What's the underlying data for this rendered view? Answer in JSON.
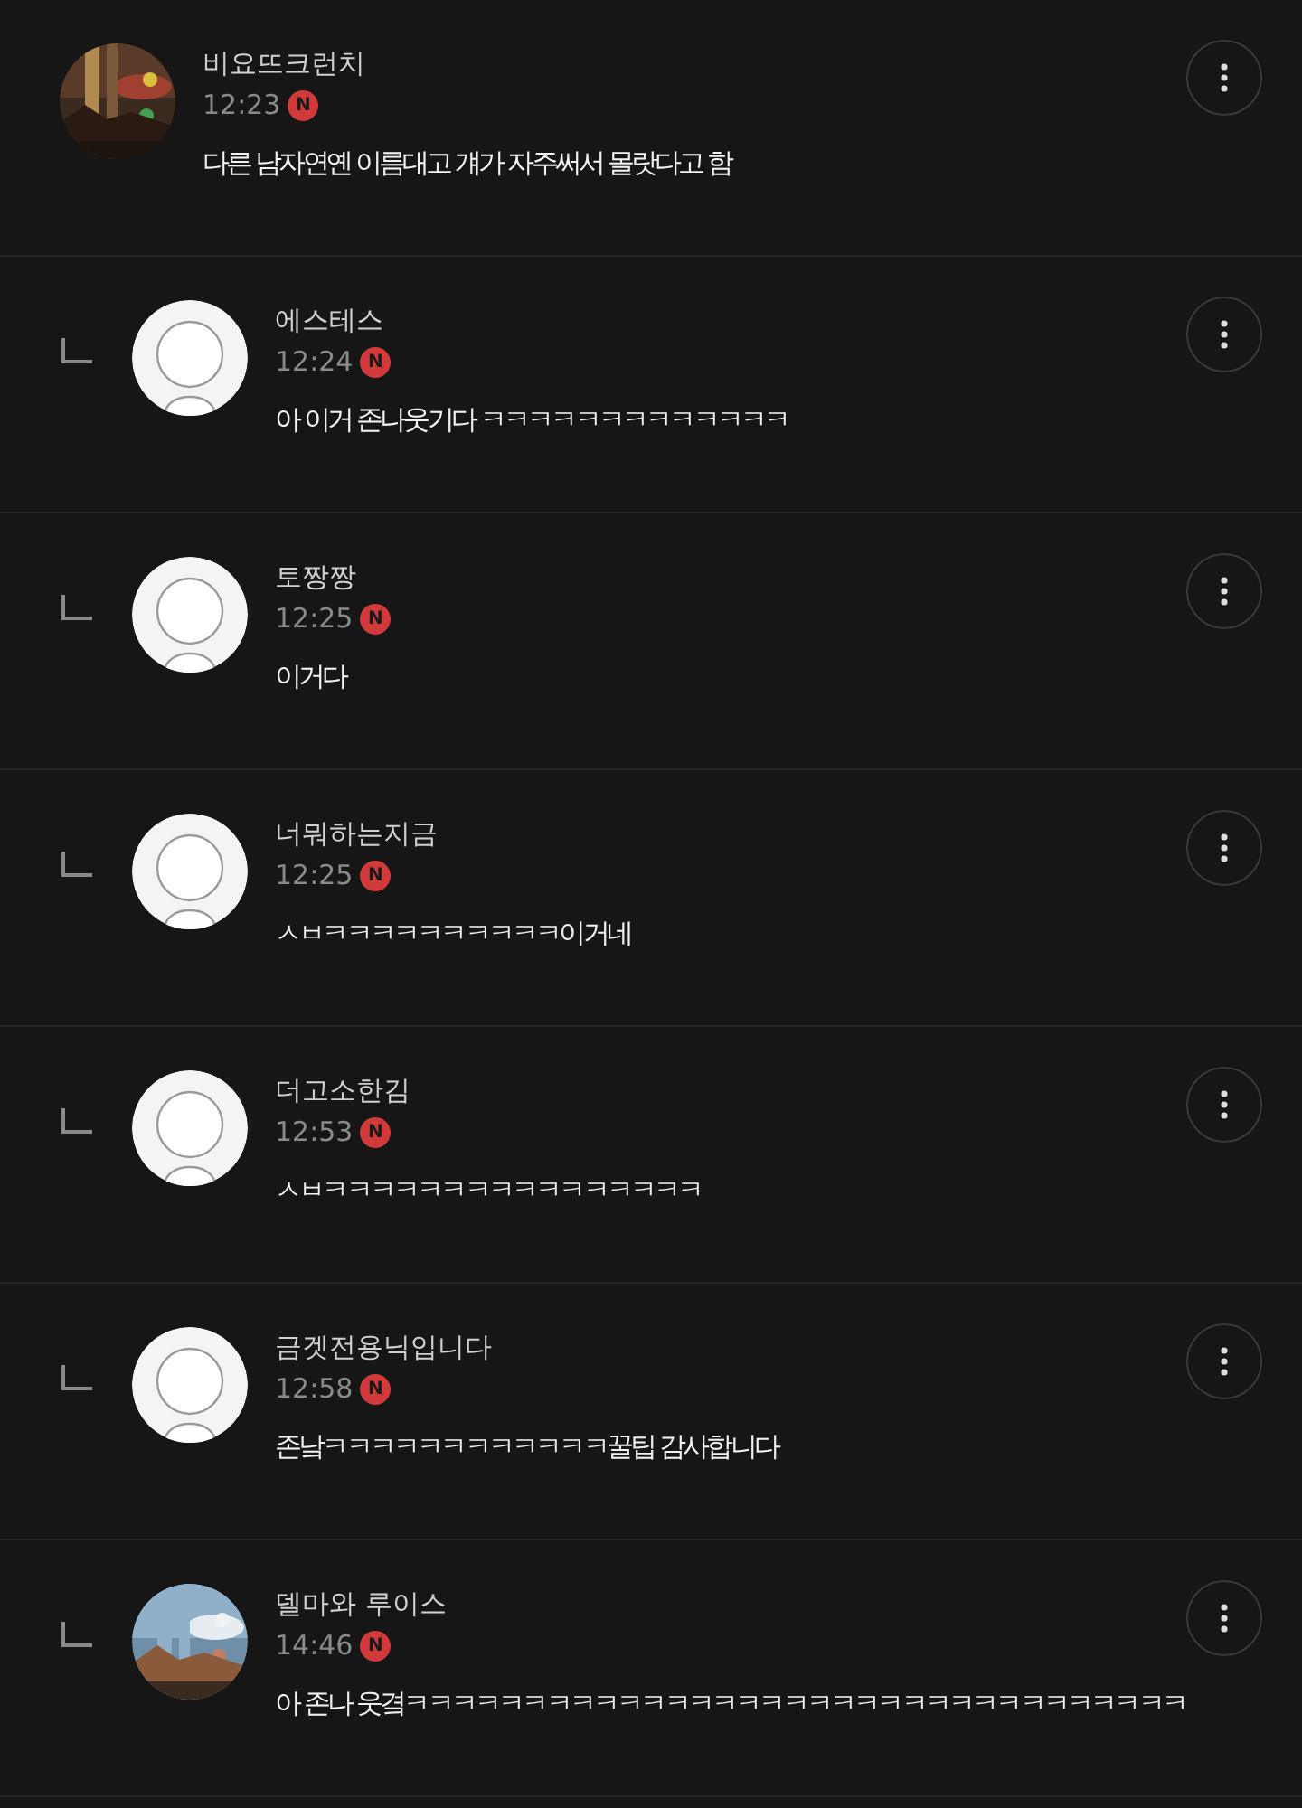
{
  "comments": [
    {
      "reply": false,
      "author": "비요뜨크런치",
      "time": "12:23",
      "badge": "N",
      "text": "다른 남자연옌 이름대고 걔가 자주써서 몰랏다고 함"
    },
    {
      "reply": true,
      "avatar": {
        "kind": "character"
      },
      "author": "에스테스",
      "time": "12:24",
      "badge": "N",
      "text": "아 이거 존나웃기다 ㅋㅋㅋㅋㅋㅋㅋㅋㅋㅋㅋㅋㅋ"
    },
    {
      "reply": true,
      "avatar": {
        "kind": "character"
      },
      "author": "토짱짱",
      "time": "12:25",
      "badge": "N",
      "text": "이거다"
    },
    {
      "reply": true,
      "avatar": {
        "kind": "character"
      },
      "author": "너뭐하는지금",
      "time": "12:25",
      "badge": "N",
      "text": "ㅅㅂㅋㅋㅋㅋㅋㅋㅋㅋㅋㅋ이거네"
    },
    {
      "reply": true,
      "avatar": {
        "kind": "character"
      },
      "author": "더고소한김",
      "time": "12:53",
      "badge": "N",
      "text": "ㅅㅂㅋㅋㅋㅋㅋㅋㅋㅋㅋㅋㅋㅋㅋㅋㅋㅋ"
    },
    {
      "reply": true,
      "avatar": {
        "kind": "character"
      },
      "author": "금겟전용닉입니다",
      "time": "12:58",
      "badge": "N",
      "text": "존낰ㅋㅋㅋㅋㅋㅋㅋㅋㅋㅋㅋㅋ꿀팁 감사합니다"
    },
    {
      "reply": true,
      "author": "델마와 루이스",
      "time": "14:46",
      "badge": "N",
      "text": "아 존나 웃곀ㅋㅋㅋㅋㅋㅋㅋㅋㅋㅋㅋㅋㅋㅋㅋㅋㅋㅋㅋㅋㅋㅋㅋㅋㅋㅋㅋㅋㅋㅋㅋㅋㅋ"
    }
  ]
}
